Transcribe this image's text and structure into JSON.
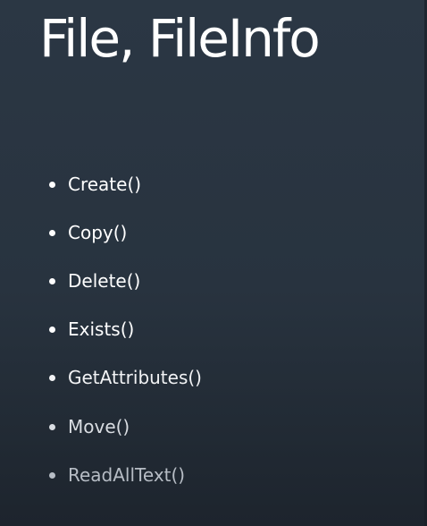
{
  "slide": {
    "title": "File, FileInfo",
    "bullets": [
      "Create()",
      "Copy()",
      "Delete()",
      "Exists()",
      "GetAttributes()",
      "Move()",
      "ReadAllText()"
    ]
  },
  "colors": {
    "background_top": "#2b3744",
    "background_bottom": "#1d242d",
    "text": "#ffffff"
  }
}
